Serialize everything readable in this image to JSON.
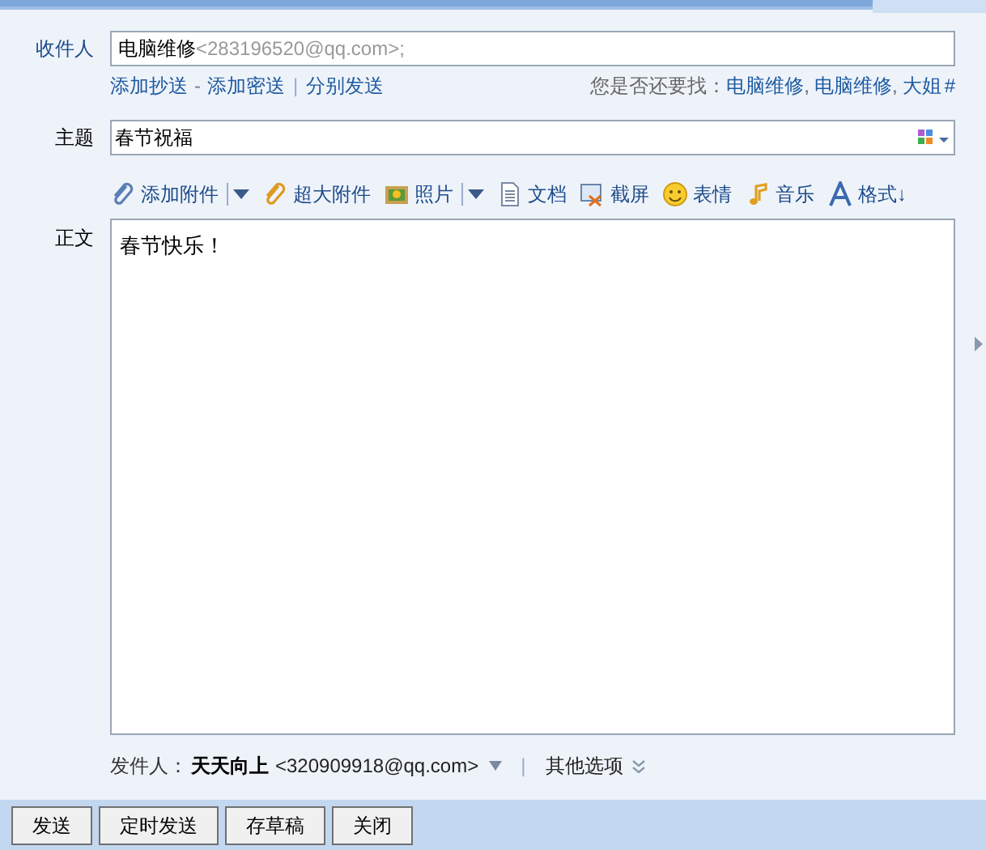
{
  "recipient": {
    "label": "收件人",
    "name": "电脑维修",
    "address": "<283196520@qq.com>;"
  },
  "recipient_links": [
    {
      "label": "添加抄送"
    },
    {
      "separator": "-",
      "label": "添加密送"
    },
    {
      "separator": "|",
      "label": "分别发送"
    }
  ],
  "suggestions": {
    "prompt": "您是否还要找：",
    "contacts": [
      {
        "label": "电脑维修"
      },
      {
        "separator": ",",
        "label": "电脑维修"
      },
      {
        "separator": ",",
        "label": "大姐"
      }
    ],
    "more": "#"
  },
  "subject": {
    "label": "主题",
    "value": "春节祝福"
  },
  "toolbar": [
    {
      "kind": "attach",
      "label": "添加附件",
      "dropdown": true
    },
    {
      "kind": "bigattach",
      "label": "超大附件",
      "dropdown": false
    },
    {
      "kind": "photo",
      "label": "照片",
      "dropdown": true
    },
    {
      "kind": "doc",
      "label": "文档",
      "dropdown": false
    },
    {
      "kind": "screenshot",
      "label": "截屏",
      "dropdown": false
    },
    {
      "kind": "emoji",
      "label": "表情",
      "dropdown": false
    },
    {
      "kind": "music",
      "label": "音乐",
      "dropdown": false
    },
    {
      "kind": "format",
      "label": "格式↓",
      "dropdown": false
    }
  ],
  "body": {
    "label": "正文",
    "value": "春节快乐！"
  },
  "sender": {
    "label": "发件人：",
    "name": "天天向上",
    "address": "<320909918@qq.com>",
    "separator": "|",
    "options": "其他选项"
  },
  "buttons": [
    "发送",
    "定时发送",
    "存草稿",
    "关闭"
  ]
}
